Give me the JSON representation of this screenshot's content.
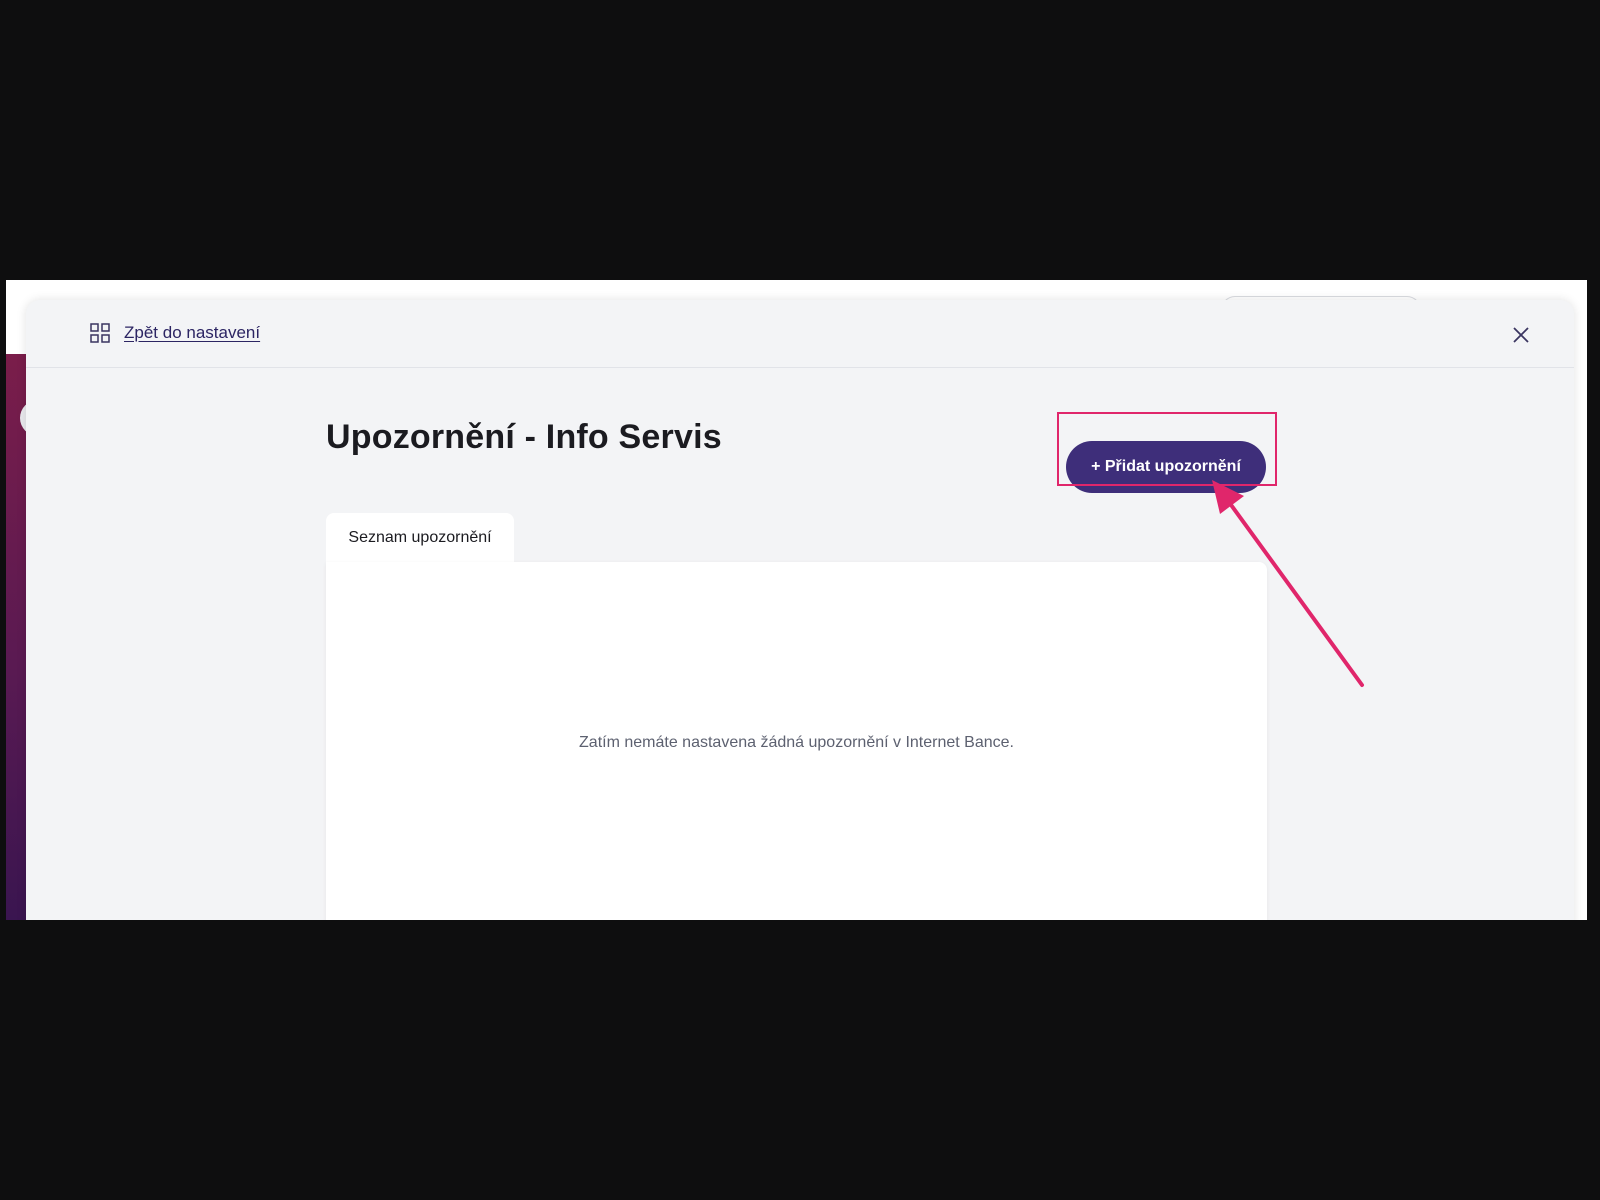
{
  "header": {
    "back_label": "Zpět do nastavení",
    "back_icon": "grid-icon",
    "close_icon": "close-icon"
  },
  "main": {
    "title": "Upozornění - Info Servis",
    "add_button_label": "+ Přidat upozornění",
    "tabs": [
      {
        "label": "Seznam upozornění",
        "active": true
      }
    ],
    "empty_message": "Zatím nemáte nastavena žádná upozornění v Internet Bance."
  },
  "annotation": {
    "color": "#e0266b",
    "target": "add-alert-button"
  },
  "colors": {
    "primary_button": "#3e2e7a",
    "link": "#2c2563",
    "modal_background": "#f3f4f6",
    "sidebar_gradient_top": "#7a1d4a",
    "sidebar_gradient_bottom": "#3a1550"
  }
}
